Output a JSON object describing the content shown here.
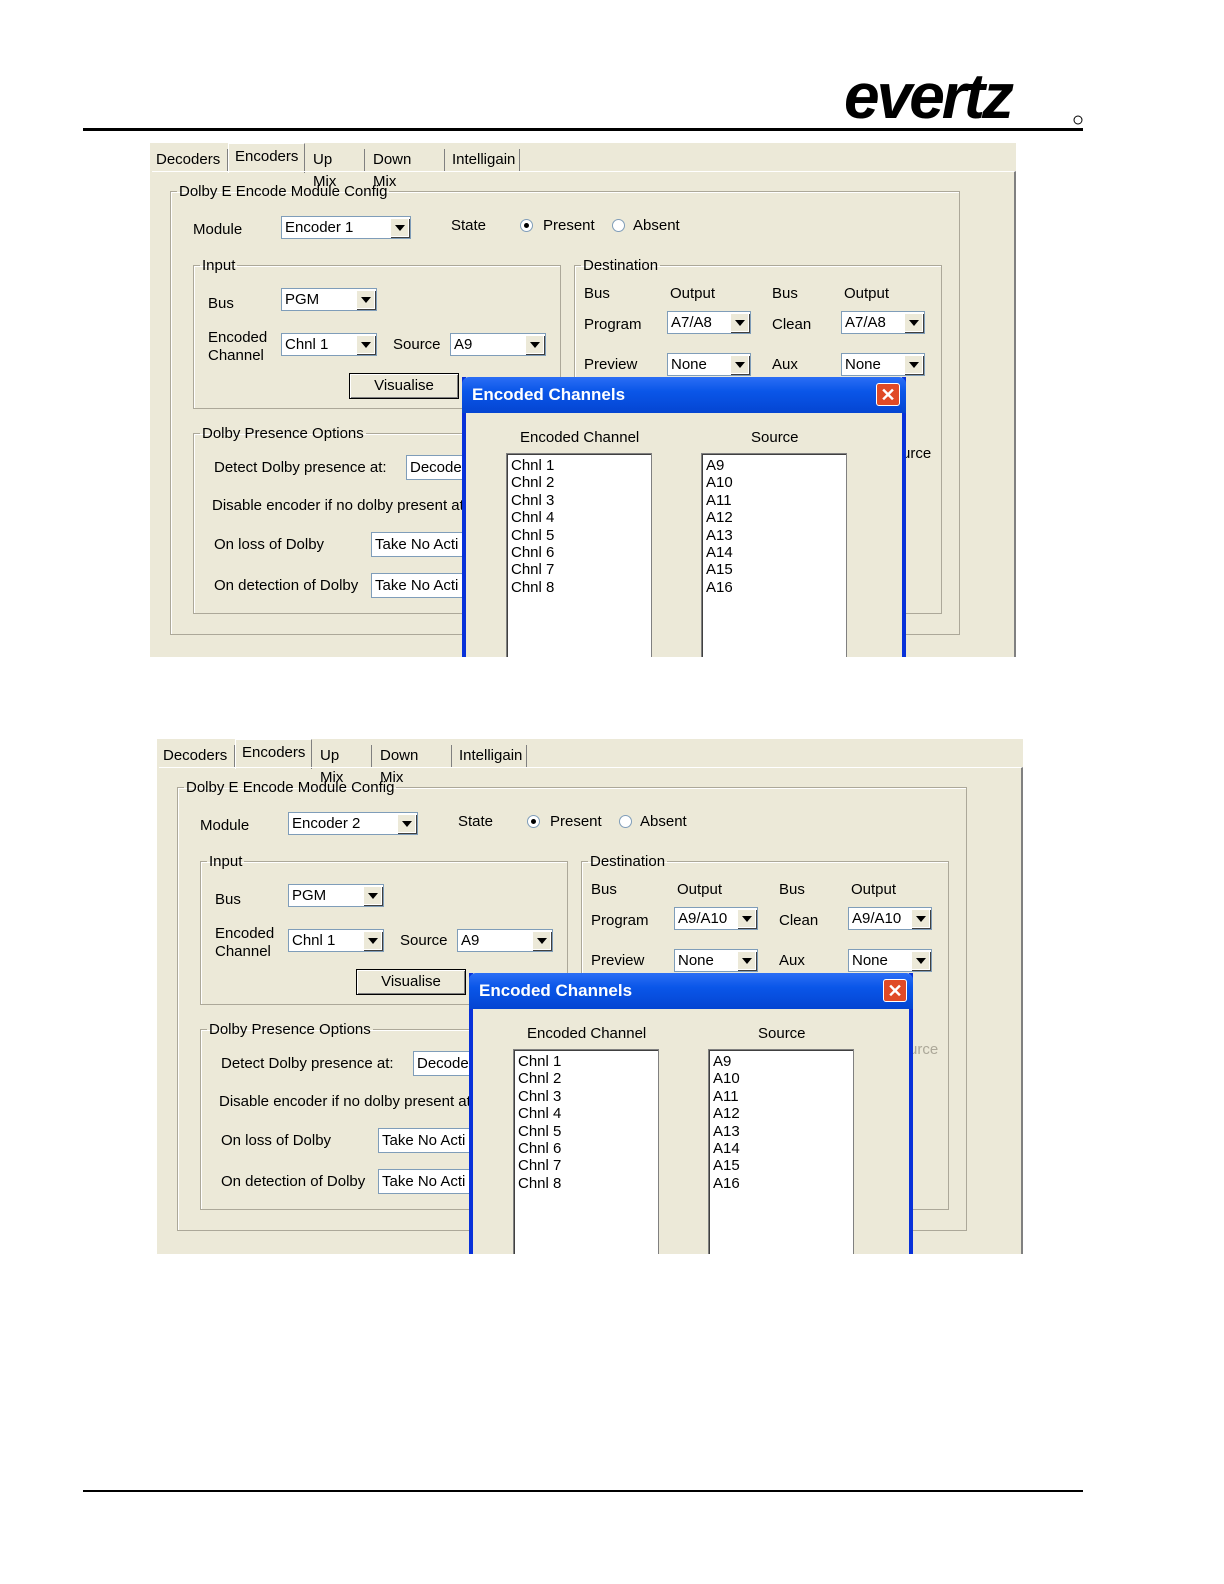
{
  "logo": {
    "text": "evertz"
  },
  "screens": [
    {
      "tabs": [
        "Decoders",
        "Encoders",
        "Up Mix",
        "Down Mix",
        "Intelligain"
      ],
      "config_group_label": "Dolby E Encode Module Config",
      "module_label": "Module",
      "module_value": "Encoder 1",
      "state_label": "State",
      "state_present": "Present",
      "state_absent": "Absent",
      "input_group_label": "Input",
      "bus_label": "Bus",
      "bus_value": "PGM",
      "encoded_channel_label_1": "Encoded",
      "encoded_channel_label_2": "Channel",
      "encoded_channel_value": "Chnl 1",
      "source_label": "Source",
      "source_value": "A9",
      "visualise_button": "Visualise",
      "destination_group_label": "Destination",
      "dest_bus_header": "Bus",
      "dest_output_header": "Output",
      "dest_bus_header_2": "Bus",
      "dest_output_header_2": "Output",
      "program_label": "Program",
      "program_value": "A7/A8",
      "clean_label": "Clean",
      "clean_value": "A7/A8",
      "preview_label": "Preview",
      "preview_value": "None",
      "aux_label": "Aux",
      "aux_value": "None",
      "presence_group_label": "Dolby Presence Options",
      "detect_label": "Detect Dolby presence at:",
      "detect_value": "Decode",
      "disable_label": "Disable encoder if no dolby present at d",
      "on_loss_label": "On loss of Dolby",
      "on_loss_value": "Take No Acti",
      "on_detect_label": "On detection of Dolby",
      "on_detect_value": "Take No Acti",
      "partial_text": "urce",
      "dialog": {
        "title": "Encoded Channels",
        "close": "✕",
        "col_channel": "Encoded Channel",
        "col_source": "Source",
        "channels": [
          "Chnl 1",
          "Chnl 2",
          "Chnl 3",
          "Chnl 4",
          "Chnl 5",
          "Chnl 6",
          "Chnl 7",
          "Chnl 8"
        ],
        "sources": [
          "A9",
          "A10",
          "A11",
          "A12",
          "A13",
          "A14",
          "A15",
          "A16"
        ]
      }
    },
    {
      "tabs": [
        "Decoders",
        "Encoders",
        "Up Mix",
        "Down Mix",
        "Intelligain"
      ],
      "config_group_label": "Dolby E Encode Module Config",
      "module_label": "Module",
      "module_value": "Encoder 2",
      "state_label": "State",
      "state_present": "Present",
      "state_absent": "Absent",
      "input_group_label": "Input",
      "bus_label": "Bus",
      "bus_value": "PGM",
      "encoded_channel_label_1": "Encoded",
      "encoded_channel_label_2": "Channel",
      "encoded_channel_value": "Chnl 1",
      "source_label": "Source",
      "source_value": "A9",
      "visualise_button": "Visualise",
      "destination_group_label": "Destination",
      "dest_bus_header": "Bus",
      "dest_output_header": "Output",
      "dest_bus_header_2": "Bus",
      "dest_output_header_2": "Output",
      "program_label": "Program",
      "program_value": "A9/A10",
      "clean_label": "Clean",
      "clean_value": "A9/A10",
      "preview_label": "Preview",
      "preview_value": "None",
      "aux_label": "Aux",
      "aux_value": "None",
      "presence_group_label": "Dolby Presence Options",
      "detect_label": "Detect Dolby presence at:",
      "detect_value": "Decode",
      "disable_label": "Disable encoder if no dolby present at d",
      "on_loss_label": "On loss of Dolby",
      "on_loss_value": "Take No Acti",
      "on_detect_label": "On detection of Dolby",
      "on_detect_value": "Take No Acti",
      "partial_text": "urce",
      "dialog": {
        "title": "Encoded Channels",
        "close": "✕",
        "col_channel": "Encoded Channel",
        "col_source": "Source",
        "channels": [
          "Chnl 1",
          "Chnl 2",
          "Chnl 3",
          "Chnl 4",
          "Chnl 5",
          "Chnl 6",
          "Chnl 7",
          "Chnl 8"
        ],
        "sources": [
          "A9",
          "A10",
          "A11",
          "A12",
          "A13",
          "A14",
          "A15",
          "A16"
        ]
      }
    }
  ]
}
